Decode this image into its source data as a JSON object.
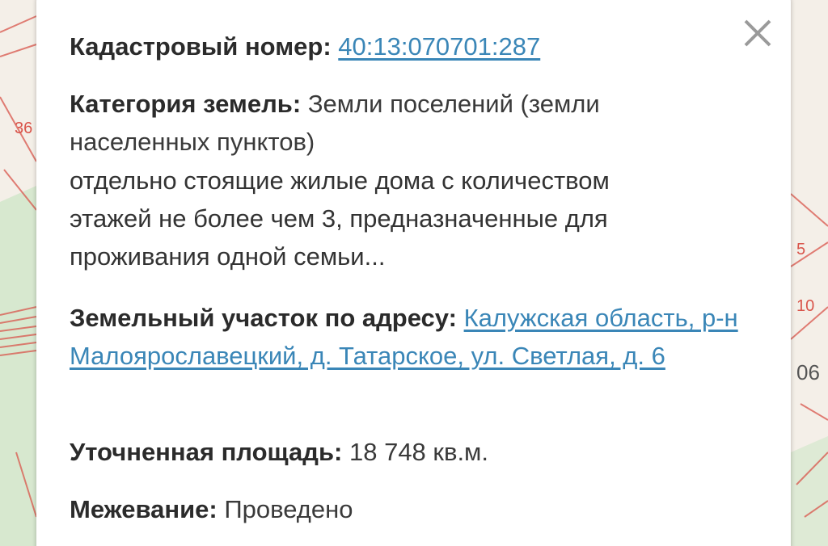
{
  "colors": {
    "link": "#3a86b7",
    "label": "#2b2b2b",
    "text": "#3a3a3a",
    "map_lines": "#d9554b",
    "map_green": "#cfe6c8"
  },
  "popup": {
    "close_icon": "close-x-icon",
    "cadastral": {
      "label": "Кадастровый номер:",
      "value": "40:13:070701:287"
    },
    "category": {
      "label": "Категория земель:",
      "value": "Земли поселений (земли населенных пунктов)",
      "usage": "отдельно стоящие жилые дома с количеством этажей не более чем 3, предназначенные для проживания одной семьи..."
    },
    "address": {
      "label": "Земельный участок по адресу:",
      "value": "Калужская область, р-н Малоярославецкий, д. Татарское, ул. Светлая, д. 6"
    },
    "area": {
      "label": "Уточненная площадь:",
      "value": "18 748 кв.м."
    },
    "survey": {
      "label": "Межевание:",
      "value": "Проведено"
    }
  },
  "map": {
    "labels": [
      "36",
      "5",
      "10",
      "06"
    ]
  }
}
